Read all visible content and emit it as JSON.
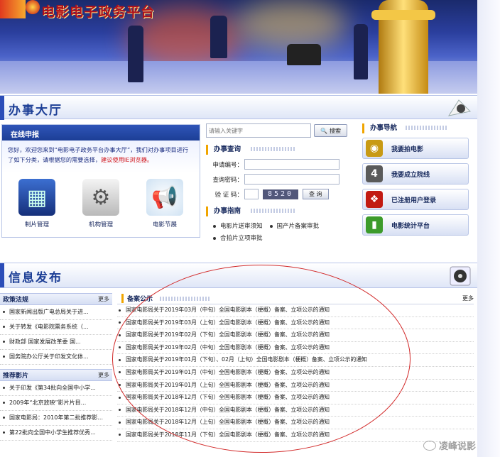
{
  "banner": {
    "title": "电影电子政务平台"
  },
  "sections": {
    "hall_title": "办事大厅",
    "info_title": "信息发布"
  },
  "online": {
    "title": "在线申报",
    "intro": "您好，欢迎您来到“电影电子政务平台办事大厅”，我们对办事项目进行了如下分类，请根据您的需要选择，",
    "intro_red": "建议使用IE浏览器。",
    "items": [
      {
        "label": "制片管理",
        "icon": "film-reel-icon"
      },
      {
        "label": "机构管理",
        "icon": "gear-box-icon"
      },
      {
        "label": "电影节展",
        "icon": "megaphone-icon"
      }
    ]
  },
  "search": {
    "placeholder": "请输入关键字",
    "button": "搜索"
  },
  "query": {
    "title": "办事查询",
    "fields": [
      {
        "label": "申请编号："
      },
      {
        "label": "查询密码："
      },
      {
        "label": "验 证 码："
      }
    ],
    "captcha": "8520",
    "button": "查 询"
  },
  "guide": {
    "title": "办事指南",
    "items": [
      "电影片送审须知",
      "国产片备案审批",
      "合拍片立项审批"
    ]
  },
  "nav": {
    "title": "办事导航",
    "items": [
      {
        "label": "我要拍电影",
        "color": "#c89a14"
      },
      {
        "label": "我要成立院线",
        "color": "#5a5a5a"
      },
      {
        "label": "已注册用户登录",
        "color": "#c21b12"
      },
      {
        "label": "电影统计平台",
        "color": "#3c9b2b"
      }
    ]
  },
  "policy": {
    "title": "政策法规",
    "more": "更多",
    "items": [
      "国家新闻出版广电总局关于进...",
      "关于转发《电影院票务系统（...",
      "财政部 国家发展改革委 国...",
      "国务院办公厅关于印发文化体..."
    ]
  },
  "recommend": {
    "title": "推荐影片",
    "more": "更多",
    "items": [
      "关于印发《第34批向全国中小学...",
      "2009年“北京放映”影片片目...",
      "国家电影局：2010年第二批推荐影...",
      "第22批向全国中小学生推荐优秀..."
    ]
  },
  "beian": {
    "title": "备案公示",
    "more": "更多",
    "items": [
      "国家电影局关于2019年03月（中旬）全国电影剧本（梗概）备案、立项公示的通知",
      "国家电影局关于2019年03月（上旬）全国电影剧本（梗概）备案、立项公示的通知",
      "国家电影局关于2019年02月（下旬）全国电影剧本（梗概）备案、立项公示的通知",
      "国家电影局关于2019年02月（中旬）全国电影剧本（梗概）备案、立项公示的通知",
      "国家电影局关于2019年01月（下旬）、02月（上旬）全国电影剧本（梗概）备案、立项公示的通知",
      "国家电影局关于2019年01月（中旬）全国电影剧本（梗概）备案、立项公示的通知",
      "国家电影局关于2019年01月（上旬）全国电影剧本（梗概）备案、立项公示的通知",
      "国家电影局关于2018年12月（下旬）全国电影剧本（梗概）备案、立项公示的通知",
      "国家电影局关于2018年12月（中旬）全国电影剧本（梗概）备案、立项公示的通知",
      "国家电影局关于2018年12月（上旬）全国电影剧本（梗概）备案、立项公示的通知",
      "国家电影局关于2018年11月（下旬）全国电影剧本（梗概）备案、立项公示的通知"
    ]
  },
  "watermark": "凌峰说影"
}
